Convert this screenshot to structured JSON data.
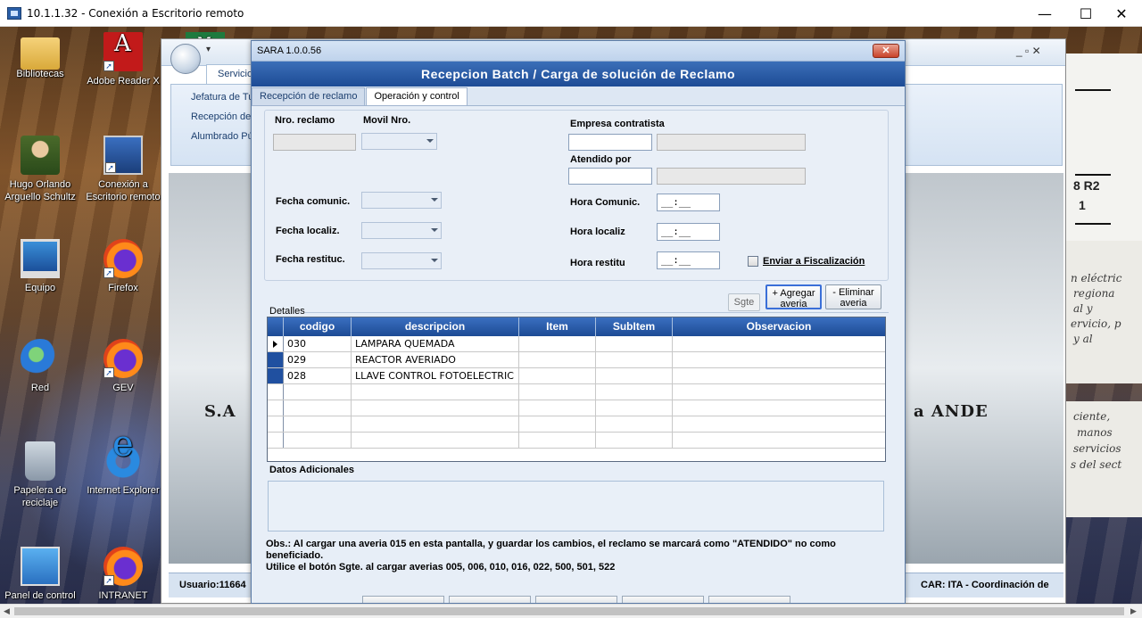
{
  "rdp": {
    "title": "10.1.1.32 - Conexión a Escritorio remoto",
    "minimize": "—",
    "maximize": "☐",
    "close": "✕"
  },
  "desktop_icons": [
    {
      "label": "Bibliotecas",
      "icon": "folder-icon"
    },
    {
      "label": "Adobe Reader X",
      "icon": "pdf-icon"
    },
    {
      "label": "Hugo Orlando Arguello Schultz",
      "icon": "user-folder-icon"
    },
    {
      "label": "Conexión a Escritorio remoto",
      "icon": "remote-desktop-icon"
    },
    {
      "label": "Equipo",
      "icon": "computer-icon"
    },
    {
      "label": "Firefox",
      "icon": "firefox-icon"
    },
    {
      "label": "Red",
      "icon": "network-icon"
    },
    {
      "label": "GEV",
      "icon": "firefox-icon"
    },
    {
      "label": "Papelera de reciclaje",
      "icon": "recycle-bin-icon"
    },
    {
      "label": "Internet Explorer",
      "icon": "ie-icon"
    },
    {
      "label": "Panel de control",
      "icon": "control-panel-icon"
    },
    {
      "label": "INTRANET",
      "icon": "firefox-icon"
    }
  ],
  "bg_app": {
    "tab": "Servicio",
    "menu": [
      "Jefatura de Turn",
      "Recepción de R",
      "Alumbrado Públ"
    ],
    "brand_left": "S.A",
    "brand_right": "a ANDE",
    "status_left": "Usuario:11664",
    "status_right": "CAR: ITA -  Coordinación de",
    "version_right": "8 R2",
    "version_right2": "1",
    "window_controls": "_ ▫ ✕"
  },
  "side_text": {
    "top": [
      "n eléctric",
      "regiona",
      "al y",
      "ervicio, p",
      "y al"
    ],
    "bottom": [
      "ciente,",
      "manos",
      "servicios",
      "s del sect"
    ]
  },
  "dialog": {
    "title": "SARA 1.0.0.56",
    "close": "✕",
    "header": "Recepcion Batch / Carga de solución de Reclamo",
    "tabs": [
      "Recepción de reclamo",
      "Operación y control"
    ],
    "active_tab": 1,
    "fields": {
      "nro_reclamo_label": "Nro. reclamo",
      "movil_label": "Movil Nro.",
      "empresa_label": "Empresa contratista",
      "atendido_label": "Atendido por",
      "fecha_comunic_label": "Fecha comunic.",
      "fecha_localiz_label": "Fecha localiz.",
      "fecha_restituc_label": "Fecha restituc.",
      "hora_comunic_label": "Hora Comunic.",
      "hora_localiz_label": "Hora localiz",
      "hora_restitu_label": "Hora restitu",
      "hora_comunic_value": "__:__",
      "hora_localiz_value": "__:__",
      "hora_restitu_value": "__:__",
      "enviar_fiscalizacion_label": "Enviar a Fiscalización"
    },
    "buttons": {
      "sgte": "Sgte",
      "agregar": "+ Agregar averia",
      "eliminar": "- Eliminar averia"
    },
    "details_label": "Detalles",
    "grid": {
      "columns": [
        "codigo",
        "descripcion",
        "Item",
        "SubItem",
        "Observacion"
      ],
      "rows": [
        {
          "codigo": "030",
          "descripcion": "LAMPARA QUEMADA",
          "item": "",
          "subitem": "",
          "observacion": ""
        },
        {
          "codigo": "029",
          "descripcion": "REACTOR AVERIADO",
          "item": "",
          "subitem": "",
          "observacion": ""
        },
        {
          "codigo": "028",
          "descripcion": "LLAVE CONTROL FOTOELECTRIC",
          "item": "",
          "subitem": "",
          "observacion": ""
        }
      ]
    },
    "datos_adicionales_label": "Datos Adicionales",
    "obs_line1": "Obs.: Al cargar una averia 015 en esta pantalla, y guardar los cambios, el reclamo se marcará como \"ATENDIDO\" no como beneficiado.",
    "obs_line2": "Utilice el botón Sgte.  al cargar averias 005, 006, 010, 016, 022, 500, 501, 522"
  }
}
